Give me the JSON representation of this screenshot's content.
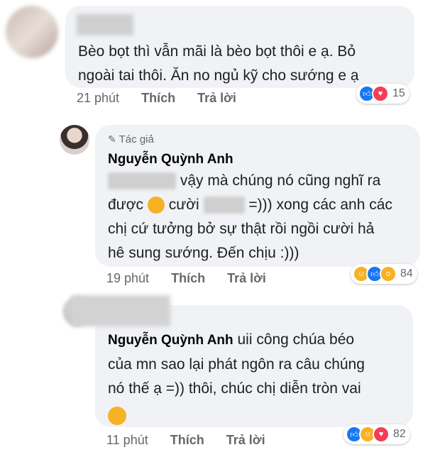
{
  "comments": [
    {
      "text_line1": "Bèo bọt thì vẫn mãi là bèo bọt thôi e ạ. Bỏ",
      "text_line2": "ngoài tai thôi. Ăn no ngủ kỹ cho sướng e ạ",
      "time": "21 phút",
      "like": "Thích",
      "reply": "Trả lời",
      "reactions": [
        "like-icon",
        "love-icon"
      ],
      "reaction_count": "15"
    },
    {
      "author_badge": "Tác giả",
      "author": "Nguyễn Quỳnh Anh",
      "line1_rest": "vậy mà chúng nó cũng nghĩ ra",
      "line2_a": "được",
      "line2_b": "cười",
      "line2_c": "=))) xong các anh các",
      "line3": "chị cứ tưởng bở sự thật rồi ngồi cười hả",
      "line4": "hê sung sướng. Đến chịu :)))",
      "time": "19 phút",
      "like": "Thích",
      "reply": "Trả lời",
      "reactions": [
        "haha-icon",
        "like-icon",
        "wow-icon"
      ],
      "reaction_count": "84"
    },
    {
      "author": "Nguyễn Quỳnh Anh",
      "line1_rest": "uii công chúa béo",
      "line2": "của mn sao lại phát ngôn ra câu chúng",
      "line3": "nó thế ạ =)) thôi, chúc chị diễn tròn vai",
      "time": "11 phút",
      "like": "Thích",
      "reply": "Trả lời",
      "reactions": [
        "like-icon",
        "haha-icon",
        "love-icon"
      ],
      "reaction_count": "82"
    }
  ],
  "colors": {
    "bubble": "#f0f2f5",
    "meta": "#65676b",
    "like": "#1877f2",
    "love": "#f33e58",
    "haha": "#f7b125"
  }
}
